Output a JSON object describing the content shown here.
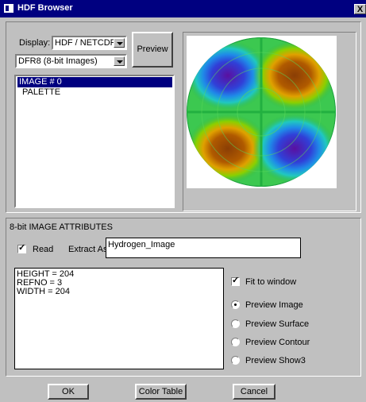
{
  "window": {
    "title": "HDF Browser",
    "close_label": "X"
  },
  "top": {
    "display_label": "Display:",
    "display_value": "HDF / NETCDF",
    "type_value": "DFR8 (8-bit Images)",
    "preview_label": "Preview",
    "items": [
      {
        "label": "IMAGE # 0",
        "selected": true
      },
      {
        "label": "PALETTE",
        "selected": false
      }
    ]
  },
  "attributes": {
    "header": "8-bit IMAGE ATTRIBUTES",
    "read_label": "Read",
    "read_checked": true,
    "extract_label": "Extract As:",
    "extract_value": "Hydrogen_Image",
    "info_lines": [
      "HEIGHT = 204",
      "REFNO = 3",
      "WIDTH = 204"
    ],
    "fit_label": "Fit to window",
    "fit_checked": true,
    "preview_options": [
      "Preview Image",
      "Preview Surface",
      "Preview Contour",
      "Preview Show3"
    ],
    "selected_option": "Preview Image"
  },
  "buttons": {
    "ok": "OK",
    "color_table": "Color Table",
    "cancel": "Cancel"
  }
}
